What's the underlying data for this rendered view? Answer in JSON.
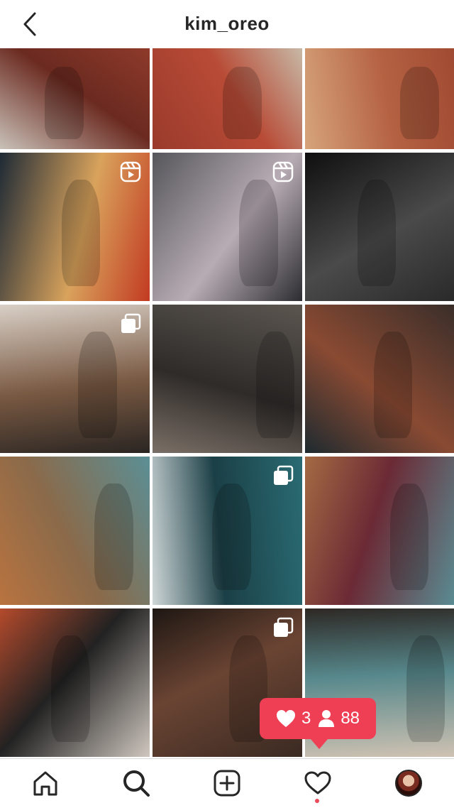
{
  "header": {
    "username": "kim_oreo",
    "back_icon": "chevron-left-icon"
  },
  "grid": {
    "posts": [
      {
        "row": 1,
        "col": 1,
        "badge": "none",
        "colors": [
          "#c9c1b8",
          "#6b2a20",
          "#8e3a2a"
        ]
      },
      {
        "row": 1,
        "col": 2,
        "badge": "none",
        "colors": [
          "#9a3a2c",
          "#b84b36",
          "#c7b9a6"
        ]
      },
      {
        "row": 1,
        "col": 3,
        "badge": "none",
        "colors": [
          "#d6a47a",
          "#b46142",
          "#a14a33"
        ]
      },
      {
        "row": 2,
        "col": 1,
        "badge": "reel",
        "colors": [
          "#1e2a36",
          "#d9a35c",
          "#c23a22"
        ]
      },
      {
        "row": 2,
        "col": 2,
        "badge": "reel",
        "colors": [
          "#55565b",
          "#b8acb4",
          "#2c2d31"
        ]
      },
      {
        "row": 2,
        "col": 3,
        "badge": "none",
        "colors": [
          "#0f0f0f",
          "#4a4a4a",
          "#2a2a2a"
        ]
      },
      {
        "row": 3,
        "col": 1,
        "badge": "carousel",
        "colors": [
          "#d9d0c7",
          "#7a5a43",
          "#2a2522"
        ]
      },
      {
        "row": 3,
        "col": 2,
        "badge": "none",
        "colors": [
          "#5b5650",
          "#2f2b29",
          "#7a6f66"
        ]
      },
      {
        "row": 3,
        "col": 3,
        "badge": "none",
        "colors": [
          "#3a2e2a",
          "#8a4a32",
          "#1e2a2f"
        ]
      },
      {
        "row": 4,
        "col": 1,
        "badge": "none",
        "colors": [
          "#5b8f96",
          "#8a6a4a",
          "#b9733f"
        ]
      },
      {
        "row": 4,
        "col": 2,
        "badge": "carousel",
        "colors": [
          "#2a6b73",
          "#1b3f46",
          "#cfd7d8"
        ]
      },
      {
        "row": 4,
        "col": 3,
        "badge": "none",
        "colors": [
          "#5a8b92",
          "#6b2a35",
          "#a46a43"
        ]
      },
      {
        "row": 5,
        "col": 1,
        "badge": "none",
        "colors": [
          "#cfc7bf",
          "#222222",
          "#b44a2c"
        ]
      },
      {
        "row": 5,
        "col": 2,
        "badge": "carousel",
        "colors": [
          "#3a2a22",
          "#6a4433",
          "#1e1713"
        ]
      },
      {
        "row": 5,
        "col": 3,
        "badge": "none",
        "colors": [
          "#cfc2b2",
          "#57888c",
          "#2d2824"
        ]
      }
    ]
  },
  "notification": {
    "likes": "3",
    "followers": "88",
    "like_icon": "heart-icon",
    "follower_icon": "person-icon",
    "color": "#ee3f55"
  },
  "tabbar": {
    "items": [
      "home-icon",
      "search-icon",
      "new-post-icon",
      "activity-icon",
      "profile-avatar"
    ],
    "active_indicator_color": "#ed4956"
  }
}
